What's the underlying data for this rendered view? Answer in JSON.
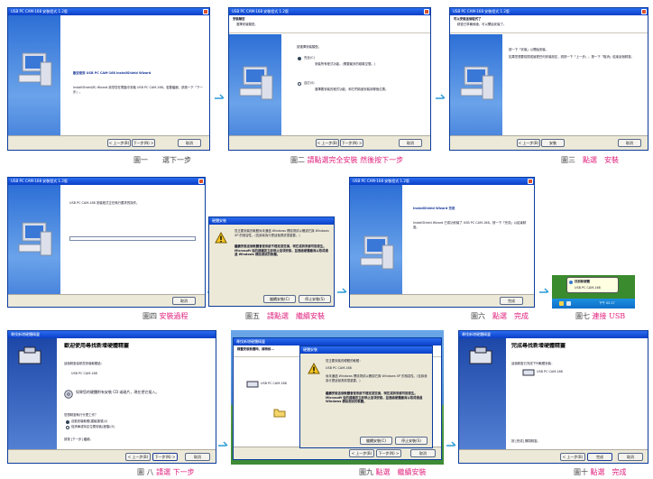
{
  "installer_title": "USB PC CAM-168 安裝程式 1.2版",
  "shield_title": "USB PC CAM-168 InstallShield Wizard",
  "fig1": {
    "welcome_heading": "歡迎使用 USB PC CAM-168 InstallShield Wizard",
    "body": "InstallShield(R) Wizard 將幫您在電腦中安裝 USB PC CAM-168。若要繼續，請按一下「下一步」。",
    "btn_back": "< 上一步(B)",
    "btn_next": "下一步(N) >",
    "btn_cancel": "取消"
  },
  "fig2": {
    "header_title": "安裝類型",
    "header_sub": "選擇安裝類型。",
    "prompt": "請選擇安裝類型。",
    "opt1": "完全(C)",
    "opt1_desc": "安裝所有程式功能。(需要最多的磁碟空間。)",
    "opt2": "自訂(S)",
    "opt2_desc": "選擇要安裝的程式功能，和它們將被安裝到哪個位置。",
    "btn_back": "< 上一步(B)",
    "btn_next": "下一步(N) >",
    "btn_cancel": "取消"
  },
  "fig3": {
    "header_title": "可以安裝這個程式了",
    "header_sub": "精靈已準備就緒，可以開始安裝了。",
    "line1": "按一下「安裝」以開始安裝。",
    "line2": "如果您想要檢閱或變更任何安裝設定，請按一下「上一步」。按一下「取消」結束這個精靈。",
    "btn_back": "< 上一步(B)",
    "btn_install": "安裝",
    "btn_cancel": "取消"
  },
  "fig4": {
    "status": "USB PC CAM-168 安裝程式正在執行要求的操作。",
    "btn_cancel": "取消"
  },
  "fig5": {
    "title": "硬體安裝",
    "warning": "您正要安裝的軟體尚未通過 Windows 標誌測試以確認它與 Windows XP 的相容性。(告訴我為什麼這個測試很重要。)",
    "warning2": "繼續安裝這個軟體會使系統不穩定或受損，現在或將來都可能發生。Microsoft 強烈建議您立即停止這項安裝，並連絡硬體廠商以取得通過 Windows 標誌測試的軟體。",
    "btn_continue": "繼續安裝(C)",
    "btn_stop": "停止安裝(S)"
  },
  "fig6": {
    "heading": "InstallShield Wizard 完成",
    "body": "InstallShield Wizard 已成功安裝了 USB PC CAM-168。按一下「完成」以結束精靈。",
    "btn_finish": "完成"
  },
  "fig7": {
    "balloon_title": "找到新硬體",
    "balloon_body": "USB PC CAM-168",
    "clock": "下午 02:17"
  },
  "fig8": {
    "title": "尋找新增硬體精靈",
    "heading": "歡迎使用尋找新增硬體精靈",
    "line1": "這個精靈協助您安裝軟體給：",
    "device": "USB PC CAM-168",
    "line2": "如果您的硬體附有安裝 CD 或磁片，現在把它插入。",
    "question": "您想精靈執行什麼工作？",
    "opt1": "自動安裝軟體(建議選項)(I)",
    "opt2": "從清單或特定位置安裝(進階)(S)",
    "line3": "請按 [下一步] 繼續。",
    "btn_back": "< 上一步(B)",
    "btn_next": "下一步(N) >",
    "btn_cancel": "取消"
  },
  "fig9": {
    "title": "尋找新增硬體精靈",
    "installing": "精靈安裝軟體時，請稍候...",
    "device": "USB PC CAM-168",
    "dlg_title": "硬體安裝",
    "warning": "您正要安裝的硬體的軟體：",
    "device2": "USB PC CAM-168",
    "warning2": "尚未通過 Windows 標誌測試以確認它與 Windows XP 的相容性。(告訴我為什麼這個測試很重要。)",
    "warning3": "繼續安裝這個軟體會使系統不穩定或受損，現在或將來都可能發生。Microsoft 強烈建議您立即停止這項安裝，並連絡硬體廠商以取得通過 Windows 標誌測試的軟體。",
    "btn_continue": "繼續安裝(C)",
    "btn_stop": "停止安裝(S)",
    "btn_back": "< 上一步(B)",
    "btn_next": "下一步(N) >",
    "btn_cancel": "取消"
  },
  "fig10": {
    "title": "尋找新增硬體精靈",
    "heading": "完成尋找新增硬體精靈",
    "line1": "這個精靈已完成下列軟體安裝：",
    "device": "USB PC CAM-168",
    "line2": "按 [完成] 關閉精靈。",
    "btn_back": "< 上一步(B)",
    "btn_finish": "完成",
    "btn_cancel": "取消"
  },
  "captions": {
    "c1a": "圖一",
    "c1b": "選下一步",
    "c2a": "圖二",
    "c2b": "請點選完全安裝 然後按下一步",
    "c3a": "圖三",
    "c3b": "點選",
    "c3c": "安裝",
    "c4a": "圖四",
    "c4b": "安裝過程",
    "c5a": "圖五",
    "c5b": "請點選",
    "c5c": "繼續安裝",
    "c6a": "圖六",
    "c6b": "點選",
    "c6c": "完成",
    "c7a": "圖七",
    "c7b": "連接 USB",
    "c8a": "圖 八",
    "c8b": "請選 下一步",
    "c9a": "圖九",
    "c9b": "點選",
    "c9c": "繼續安裝",
    "c10a": "圖十",
    "c10b": "點選",
    "c10c": "完成"
  },
  "colors": {
    "accent_caption": "#e0207c",
    "arrow": "#2a9ad8",
    "xp_title": "#0a3fc8"
  }
}
